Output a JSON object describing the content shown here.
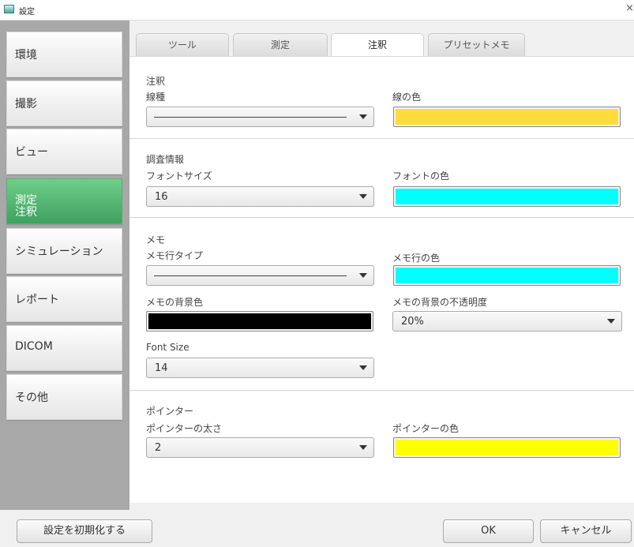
{
  "window": {
    "title": "設定",
    "close_glyph": "×"
  },
  "sidebar": {
    "items": [
      {
        "label": "環境"
      },
      {
        "label": "撮影"
      },
      {
        "label": "ビュー"
      },
      {
        "label": "測定\n注釈",
        "active": true
      },
      {
        "label": "シミュレーション"
      },
      {
        "label": "レポート"
      },
      {
        "label": "DICOM"
      },
      {
        "label": "その他"
      }
    ]
  },
  "tabs": [
    {
      "label": "ツール"
    },
    {
      "label": "測定"
    },
    {
      "label": "注釈",
      "active": true
    },
    {
      "label": "プリセットメモ"
    }
  ],
  "annotation": {
    "title": "注釈",
    "line_type_label": "線種",
    "line_color_label": "線の色",
    "line_color": "#fddc3c"
  },
  "survey": {
    "title": "調査情報",
    "font_size_label": "フォントサイズ",
    "font_size_value": "16",
    "font_color_label": "フォントの色",
    "font_color": "#00ffff"
  },
  "memo": {
    "title": "メモ",
    "line_type_label": "メモ行タイプ",
    "line_color_label": "メモ行の色",
    "line_color": "#00ffff",
    "bg_color_label": "メモの背景色",
    "bg_color": "#000000",
    "bg_opacity_label": "メモの背景の不透明度",
    "bg_opacity_value": "20%",
    "font_size_label": "Font Size",
    "font_size_value": "14"
  },
  "pointer": {
    "title": "ポインター",
    "thickness_label": "ポインターの太さ",
    "thickness_value": "2",
    "color_label": "ポインターの色",
    "color": "#ffff00"
  },
  "footer": {
    "reset_label": "設定を初期化する",
    "ok_label": "OK",
    "cancel_label": "キャンセル"
  }
}
